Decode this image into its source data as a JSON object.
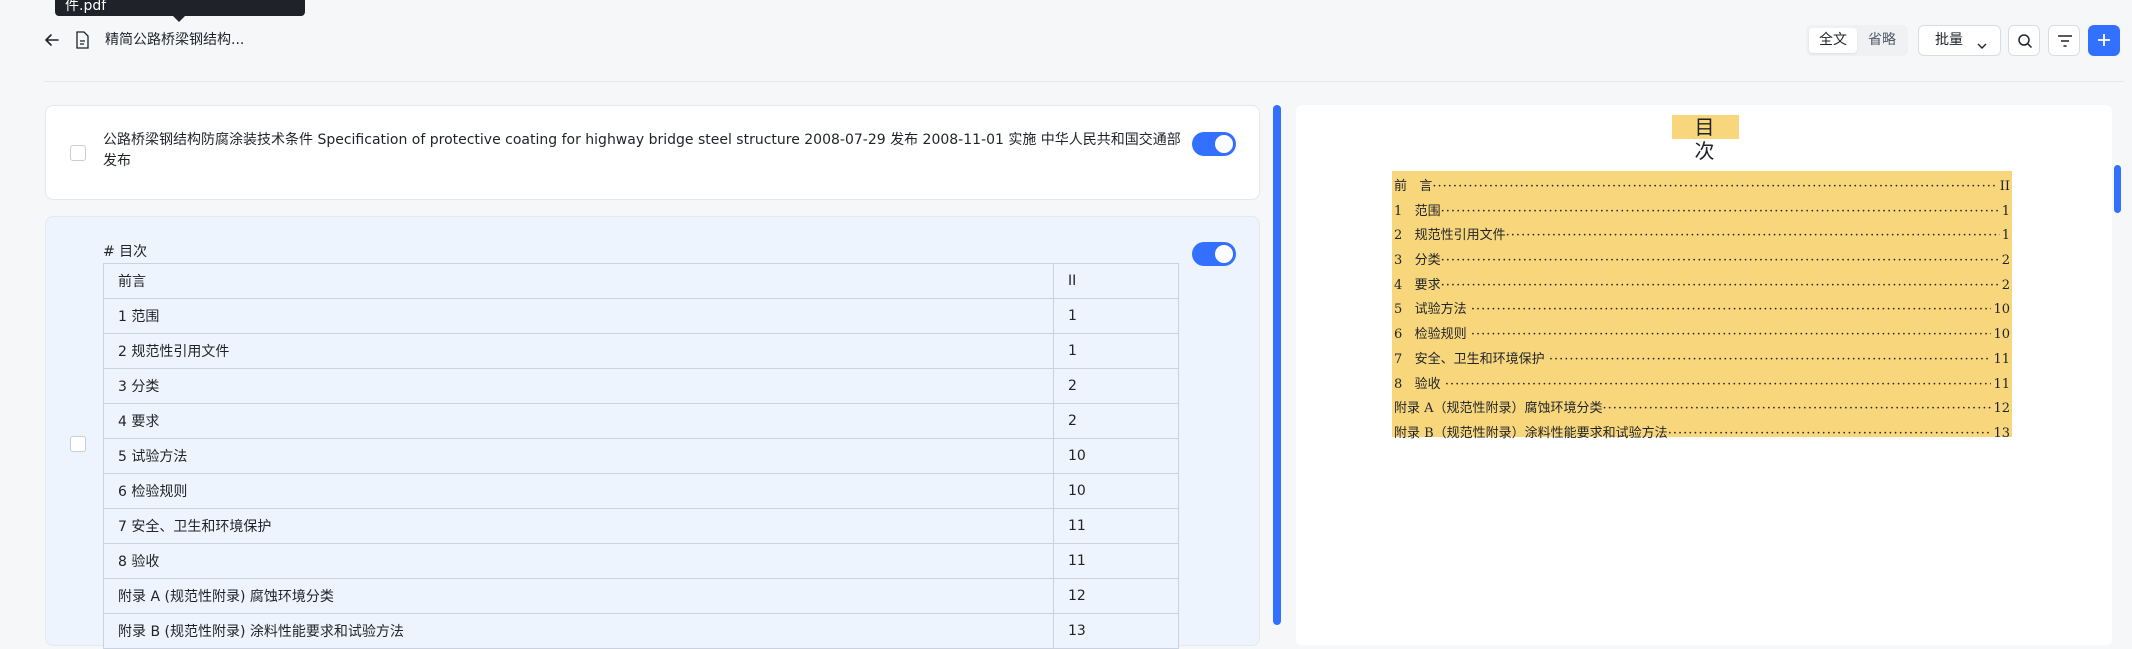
{
  "tooltip": {
    "text": "件.pdf"
  },
  "header": {
    "doc_title": "精简公路桥梁钢结构...",
    "view_modes": [
      {
        "label": "全文",
        "active": true
      },
      {
        "label": "省略",
        "active": false
      }
    ],
    "batch_label": "批量"
  },
  "cards": [
    {
      "text": "公路桥梁钢结构防腐涂装技术条件 Specification of protective coating for highway bridge steel structure 2008-07-29 发布 2008-11-01 实施 中华人民共和国交通部 发布",
      "enabled": true
    },
    {
      "heading": "# 目次",
      "enabled": true,
      "rows": [
        {
          "label": "前言",
          "page": "II"
        },
        {
          "label": "1 范围",
          "page": "1"
        },
        {
          "label": "2 规范性引用文件",
          "page": "1"
        },
        {
          "label": "3 分类",
          "page": "2"
        },
        {
          "label": "4 要求",
          "page": "2"
        },
        {
          "label": "5 试验方法",
          "page": "10"
        },
        {
          "label": "6 检验规则",
          "page": "10"
        },
        {
          "label": "7 安全、卫生和环境保护",
          "page": "11"
        },
        {
          "label": "8 验收",
          "page": "11"
        },
        {
          "label": "附录 A (规范性附录) 腐蚀环境分类",
          "page": "12"
        },
        {
          "label": "附录 B (规范性附录) 涂料性能要求和试验方法",
          "page": "13"
        }
      ]
    }
  ],
  "preview": {
    "title": "目 次",
    "highlight_color": "#f8d77c",
    "lines": [
      {
        "label": "前   言",
        "page": "II"
      },
      {
        "label": "1   范围",
        "page": "1"
      },
      {
        "label": "2   规范性引用文件",
        "page": "1"
      },
      {
        "label": "3   分类",
        "page": "2"
      },
      {
        "label": "4   要求",
        "page": "2"
      },
      {
        "label": "5   试验方法 ",
        "page": "10"
      },
      {
        "label": "6   检验规则 ",
        "page": "10"
      },
      {
        "label": "7   安全、卫生和环境保护 ",
        "page": "11"
      },
      {
        "label": "8   验收 ",
        "page": "11"
      },
      {
        "label": "附录 A（规范性附录）腐蚀环境分类",
        "page": "12"
      },
      {
        "label": "附录 B（规范性附录）涂料性能要求和试验方法",
        "page": "13"
      }
    ]
  },
  "colors": {
    "accent": "#3370ff",
    "highlight": "#f8d77c"
  }
}
